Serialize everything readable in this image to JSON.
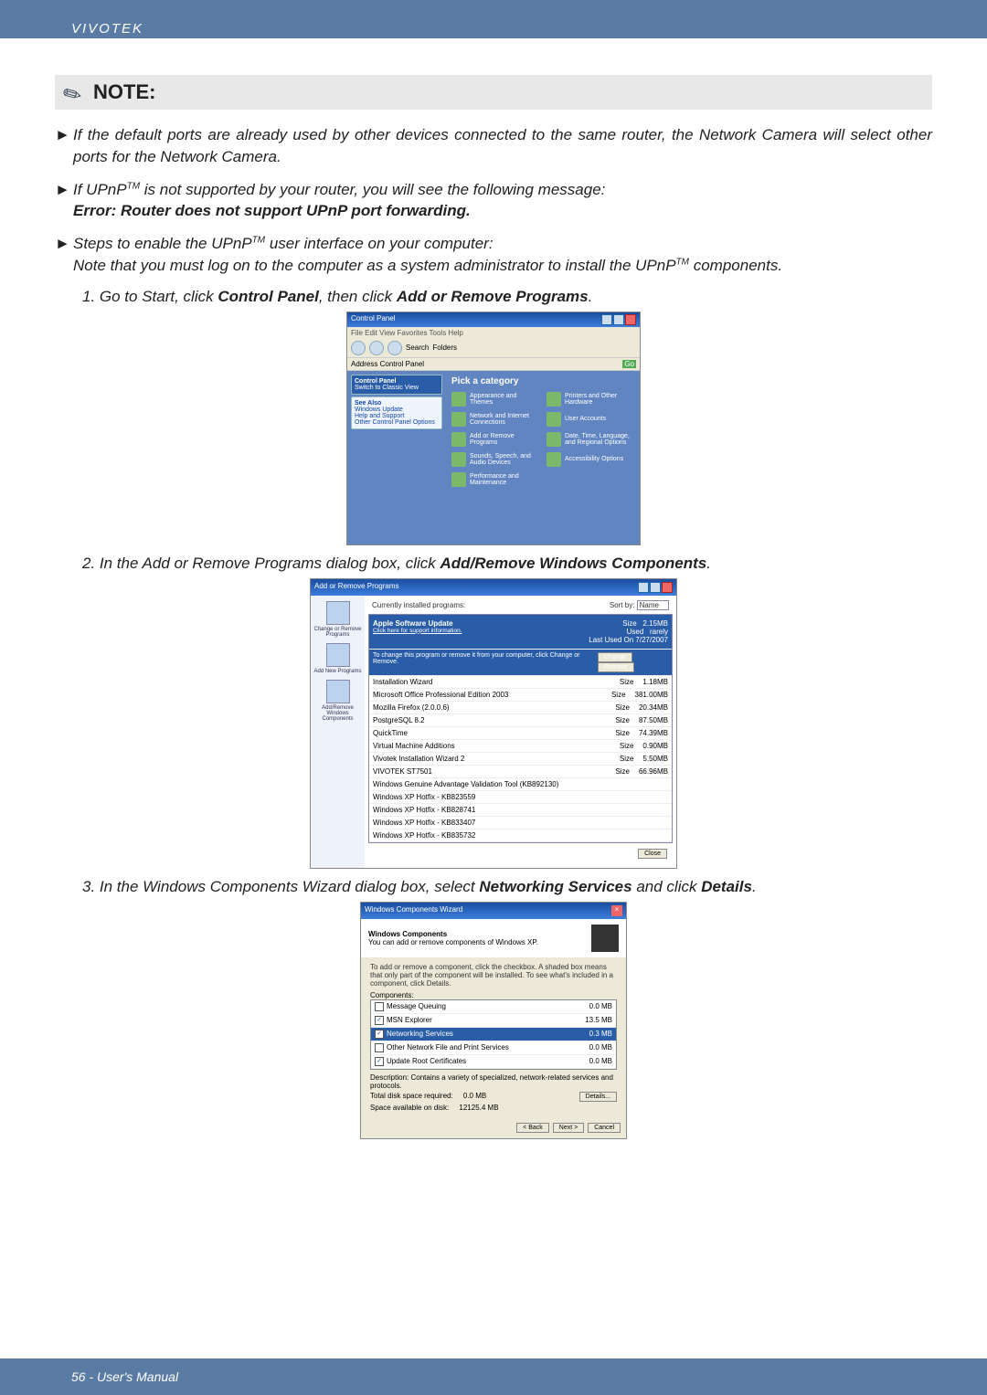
{
  "header": {
    "brand": "VIVOTEK"
  },
  "note": {
    "label": "NOTE:"
  },
  "bullets": {
    "b1": "If the default ports are already used by other devices connected to the same router, the Network Camera will select other ports for the Network Camera.",
    "b2_line1_prefix": "If UPnP",
    "b2_line1_suffix": " is not supported by your router, you will see the following message:",
    "b2_error": "Error: Router does not support UPnP port forwarding.",
    "b3_line1_prefix": "Steps to enable the UPnP",
    "b3_line1_suffix": " user interface on your computer:",
    "b3_line2_prefix": "Note that you must log on to the computer as a system administrator to install the UPnP",
    "b3_line2_suffix": " components.",
    "tm": "TM"
  },
  "steps": {
    "s1_a": "1. Go to Start, click ",
    "s1_b": "Control Panel",
    "s1_c": ", then click ",
    "s1_d": "Add or Remove Programs",
    "s1_e": ".",
    "s2_a": "2. In the Add or Remove Programs dialog box, click ",
    "s2_b": "Add/Remove Windows Components",
    "s2_c": ".",
    "s3_a": "3. In the Windows Components Wizard dialog box, select ",
    "s3_b": "Networking Services",
    "s3_c": " and click ",
    "s3_d": "Details",
    "s3_e": "."
  },
  "cp": {
    "title": "Control Panel",
    "menus": "File   Edit   View   Favorites   Tools   Help",
    "search": "Search",
    "folders": "Folders",
    "address_label": "Address",
    "address_value": "Control Panel",
    "go": "Go",
    "side_card1_title": "Control Panel",
    "side_card1_item": "Switch to Classic View",
    "side_seealso_title": "See Also",
    "side_seealso_1": "Windows Update",
    "side_seealso_2": "Help and Support",
    "side_seealso_3": "Other Control Panel Options",
    "main_title": "Pick a category",
    "cats": {
      "c1": "Appearance and Themes",
      "c2": "Printers and Other Hardware",
      "c3": "Network and Internet Connections",
      "c4": "User Accounts",
      "c5": "Add or Remove Programs",
      "c6": "Date, Time, Language, and Regional Options",
      "c7": "Sounds, Speech, and Audio Devices",
      "c8": "Accessibility Options",
      "c9": "Performance and Maintenance"
    }
  },
  "arp": {
    "title": "Add or Remove Programs",
    "side": {
      "b1": "Change or Remove Programs",
      "b2": "Add New Programs",
      "b3": "Add/Remove Windows Components"
    },
    "top_label": "Currently installed programs:",
    "sort_label": "Sort by:",
    "sort_value": "Name",
    "selected": {
      "name": "Apple Software Update",
      "support": "Click here for support information.",
      "hint": "To change this program or remove it from your computer, click Change or Remove.",
      "size_label": "Size",
      "size": "2.15MB",
      "used_label": "Used",
      "used": "rarely",
      "lastused_label": "Last Used On",
      "lastused": "7/27/2007",
      "change_btn": "Change",
      "remove_btn": "Remove"
    },
    "rows": [
      {
        "name": "Installation Wizard",
        "size_l": "Size",
        "size": "1.18MB"
      },
      {
        "name": "Microsoft Office Professional Edition 2003",
        "size_l": "Size",
        "size": "381.00MB"
      },
      {
        "name": "Mozilla Firefox (2.0.0.6)",
        "size_l": "Size",
        "size": "20.34MB"
      },
      {
        "name": "PostgreSQL 8.2",
        "size_l": "Size",
        "size": "87.50MB"
      },
      {
        "name": "QuickTime",
        "size_l": "Size",
        "size": "74.39MB"
      },
      {
        "name": "Virtual Machine Additions",
        "size_l": "Size",
        "size": "0.90MB"
      },
      {
        "name": "Vivotek Installation Wizard 2",
        "size_l": "Size",
        "size": "5.50MB"
      },
      {
        "name": "VIVOTEK ST7501",
        "size_l": "Size",
        "size": "66.96MB"
      },
      {
        "name": "Windows Genuine Advantage Validation Tool (KB892130)",
        "size_l": "",
        "size": ""
      },
      {
        "name": "Windows XP Hotfix - KB823559",
        "size_l": "",
        "size": ""
      },
      {
        "name": "Windows XP Hotfix - KB828741",
        "size_l": "",
        "size": ""
      },
      {
        "name": "Windows XP Hotfix - KB833407",
        "size_l": "",
        "size": ""
      },
      {
        "name": "Windows XP Hotfix - KB835732",
        "size_l": "",
        "size": ""
      }
    ],
    "close_btn": "Close"
  },
  "wcw": {
    "title": "Windows Components Wizard",
    "heading": "Windows Components",
    "subheading": "You can add or remove components of Windows XP.",
    "instruction": "To add or remove a component, click the checkbox. A shaded box means that only part of the component will be installed. To see what's included in a component, click Details.",
    "components_label": "Components:",
    "rows": [
      {
        "checked": false,
        "name": "Message Queuing",
        "size": "0.0 MB"
      },
      {
        "checked": true,
        "name": "MSN Explorer",
        "size": "13.5 MB"
      },
      {
        "checked": true,
        "name": "Networking Services",
        "size": "0.3 MB",
        "selected": true
      },
      {
        "checked": false,
        "name": "Other Network File and Print Services",
        "size": "0.0 MB"
      },
      {
        "checked": true,
        "name": "Update Root Certificates",
        "size": "0.0 MB"
      }
    ],
    "description_label": "Description:",
    "description": "Contains a variety of specialized, network-related services and protocols.",
    "disk_required_label": "Total disk space required:",
    "disk_required": "0.0 MB",
    "disk_available_label": "Space available on disk:",
    "disk_available": "12125.4 MB",
    "details_btn": "Details...",
    "back_btn": "< Back",
    "next_btn": "Next >",
    "cancel_btn": "Cancel"
  },
  "footer": {
    "text": "56 - User's Manual"
  }
}
